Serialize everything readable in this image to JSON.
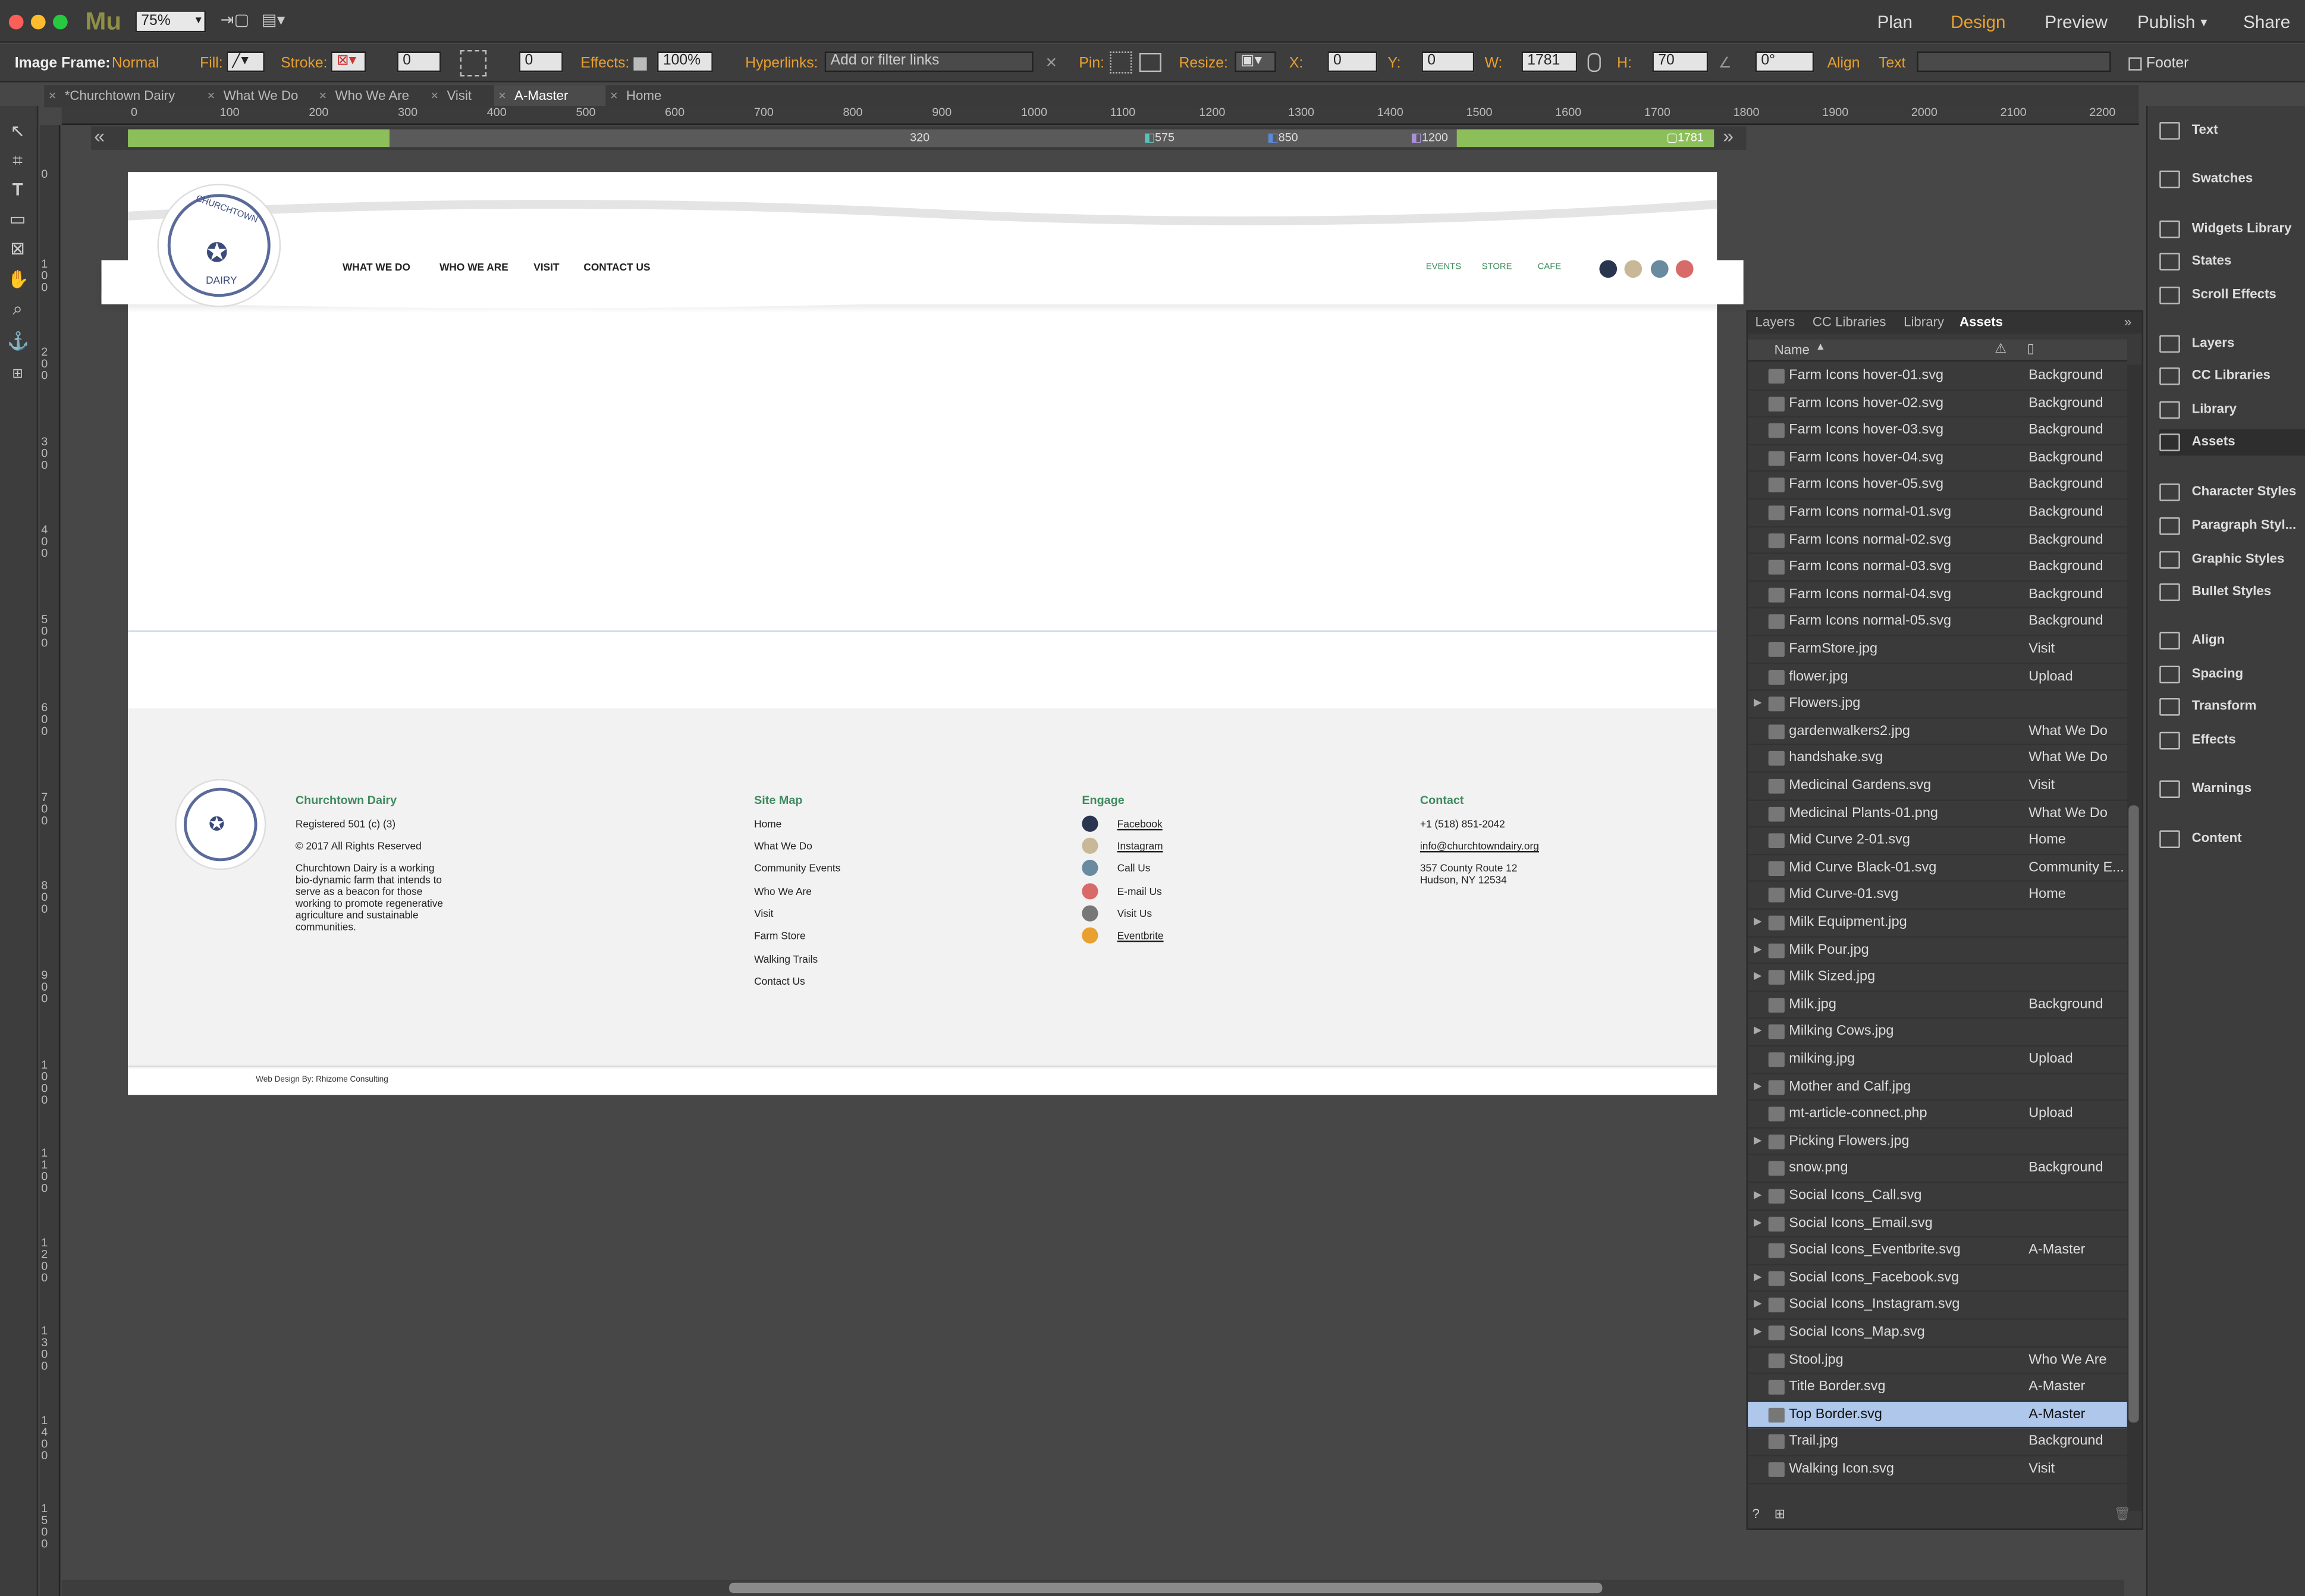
{
  "app": {
    "logo": "Mu",
    "zoom": "75%",
    "nav": [
      "Plan",
      "Design",
      "Preview",
      "Publish",
      "Share"
    ],
    "active_nav": "Design"
  },
  "controls": {
    "selection": "Image Frame:",
    "blend": "Normal",
    "fill": "Fill:",
    "stroke": "Stroke:",
    "stroke_w": "0",
    "corner_w": "0",
    "effects": "Effects:",
    "opacity": "100%",
    "hyperlinks": "Hyperlinks:",
    "link_ph": "Add or filter links",
    "pin": "Pin:",
    "resize": "Resize:",
    "x_label": "X:",
    "x": "0",
    "y_label": "Y:",
    "y": "0",
    "w_label": "W:",
    "w": "1781",
    "h_label": "H:",
    "h": "70",
    "angle": "0°",
    "align": "Align",
    "text": "Text",
    "footer": "Footer"
  },
  "tabs": [
    "*Churchtown Dairy",
    "What We Do",
    "Who We Are",
    "Visit",
    "A-Master",
    "Home"
  ],
  "ruler_h": [
    "0",
    "100",
    "200",
    "300",
    "400",
    "500",
    "600",
    "700",
    "800",
    "900",
    "1000",
    "1100",
    "1200",
    "1300",
    "1400",
    "1500",
    "1600",
    "1700",
    "1800",
    "1900",
    "2000",
    "2100",
    "2200"
  ],
  "ruler_v": [
    "0",
    "100",
    "200",
    "300",
    "400",
    "500",
    "600",
    "700",
    "800",
    "900",
    "1000",
    "1100",
    "1200",
    "1300",
    "1400",
    "1500"
  ],
  "breakpoints": {
    "min": "320",
    "b1": "575",
    "b2": "850",
    "b3": "1200",
    "max": "1781"
  },
  "site": {
    "logo": [
      "CHURCHTOWN",
      "DAIRY"
    ],
    "nav": [
      "WHAT WE DO",
      "WHO WE ARE",
      "VISIT",
      "CONTACT US"
    ],
    "nav_right": [
      "EVENTS",
      "STORE",
      "CAFE"
    ],
    "footer": {
      "about_title": "Churchtown Dairy",
      "about_lines": [
        "Registered 501 (c) (3)",
        "© 2017 All Rights Reserved",
        "Churchtown Dairy is a working bio-dynamic farm that intends to serve as a beacon for those working to promote regenerative agriculture and sustainable communities."
      ],
      "sitemap_title": "Site Map",
      "sitemap": [
        "Home",
        "What We Do",
        "Community Events",
        "Who We Are",
        "Visit",
        "Farm Store",
        "Walking Trails",
        "Contact Us"
      ],
      "engage_title": "Engage",
      "engage": [
        "Facebook",
        "Instagram",
        "Call Us",
        "E-mail Us",
        "Visit Us",
        "Eventbrite"
      ],
      "contact_title": "Contact",
      "contact": [
        "+1 (518) 851-2042",
        "info@churchtowndairy.org",
        "357 County Route 12",
        "Hudson, NY 12534"
      ],
      "credit": "Web Design By: Rhizome Consulting"
    }
  },
  "right_panel": [
    "Text",
    "Swatches",
    "Widgets Library",
    "States",
    "Scroll Effects",
    "Layers",
    "CC Libraries",
    "Library",
    "Assets",
    "Character Styles",
    "Paragraph Styl...",
    "Graphic Styles",
    "Bullet Styles",
    "Align",
    "Spacing",
    "Transform",
    "Effects",
    "Warnings",
    "Content"
  ],
  "assets_tabs": [
    "Layers",
    "CC Libraries",
    "Library",
    "Assets"
  ],
  "assets_header": "Name",
  "assets": [
    {
      "name": "Farm Icons hover-01.svg",
      "page": "Background"
    },
    {
      "name": "Farm Icons hover-02.svg",
      "page": "Background"
    },
    {
      "name": "Farm Icons hover-03.svg",
      "page": "Background"
    },
    {
      "name": "Farm Icons hover-04.svg",
      "page": "Background"
    },
    {
      "name": "Farm Icons hover-05.svg",
      "page": "Background"
    },
    {
      "name": "Farm Icons normal-01.svg",
      "page": "Background"
    },
    {
      "name": "Farm Icons normal-02.svg",
      "page": "Background"
    },
    {
      "name": "Farm Icons normal-03.svg",
      "page": "Background"
    },
    {
      "name": "Farm Icons normal-04.svg",
      "page": "Background"
    },
    {
      "name": "Farm Icons normal-05.svg",
      "page": "Background"
    },
    {
      "name": "FarmStore.jpg",
      "page": "Visit"
    },
    {
      "name": "flower.jpg",
      "page": "Upload"
    },
    {
      "name": "Flowers.jpg",
      "page": ""
    },
    {
      "name": "gardenwalkers2.jpg",
      "page": "What We Do"
    },
    {
      "name": "handshake.svg",
      "page": "What We Do"
    },
    {
      "name": "Medicinal Gardens.svg",
      "page": "Visit"
    },
    {
      "name": "Medicinal Plants-01.png",
      "page": "What We Do"
    },
    {
      "name": "Mid Curve 2-01.svg",
      "page": "Home"
    },
    {
      "name": "Mid Curve Black-01.svg",
      "page": "Community E..."
    },
    {
      "name": "Mid Curve-01.svg",
      "page": "Home"
    },
    {
      "name": "Milk Equipment.jpg",
      "page": ""
    },
    {
      "name": "Milk Pour.jpg",
      "page": ""
    },
    {
      "name": "Milk Sized.jpg",
      "page": ""
    },
    {
      "name": "Milk.jpg",
      "page": "Background"
    },
    {
      "name": "Milking Cows.jpg",
      "page": ""
    },
    {
      "name": "milking.jpg",
      "page": "Upload"
    },
    {
      "name": "Mother and Calf.jpg",
      "page": ""
    },
    {
      "name": "mt-article-connect.php",
      "page": "Upload"
    },
    {
      "name": "Picking Flowers.jpg",
      "page": ""
    },
    {
      "name": "snow.png",
      "page": "Background"
    },
    {
      "name": "Social Icons_Call.svg",
      "page": ""
    },
    {
      "name": "Social Icons_Email.svg",
      "page": ""
    },
    {
      "name": "Social Icons_Eventbrite.svg",
      "page": "A-Master"
    },
    {
      "name": "Social Icons_Facebook.svg",
      "page": ""
    },
    {
      "name": "Social Icons_Instagram.svg",
      "page": ""
    },
    {
      "name": "Social Icons_Map.svg",
      "page": ""
    },
    {
      "name": "Stool.jpg",
      "page": "Who We Are"
    },
    {
      "name": "Title Border.svg",
      "page": "A-Master"
    },
    {
      "name": "Top Border.svg",
      "page": "A-Master"
    },
    {
      "name": "Trail.jpg",
      "page": "Background"
    },
    {
      "name": "Walking Icon.svg",
      "page": "Visit"
    }
  ],
  "colors": {
    "accent": "#e8a030",
    "green": "#8cbf5a",
    "selection": "#aec7ea",
    "footer_title": "#3e8a5e"
  }
}
